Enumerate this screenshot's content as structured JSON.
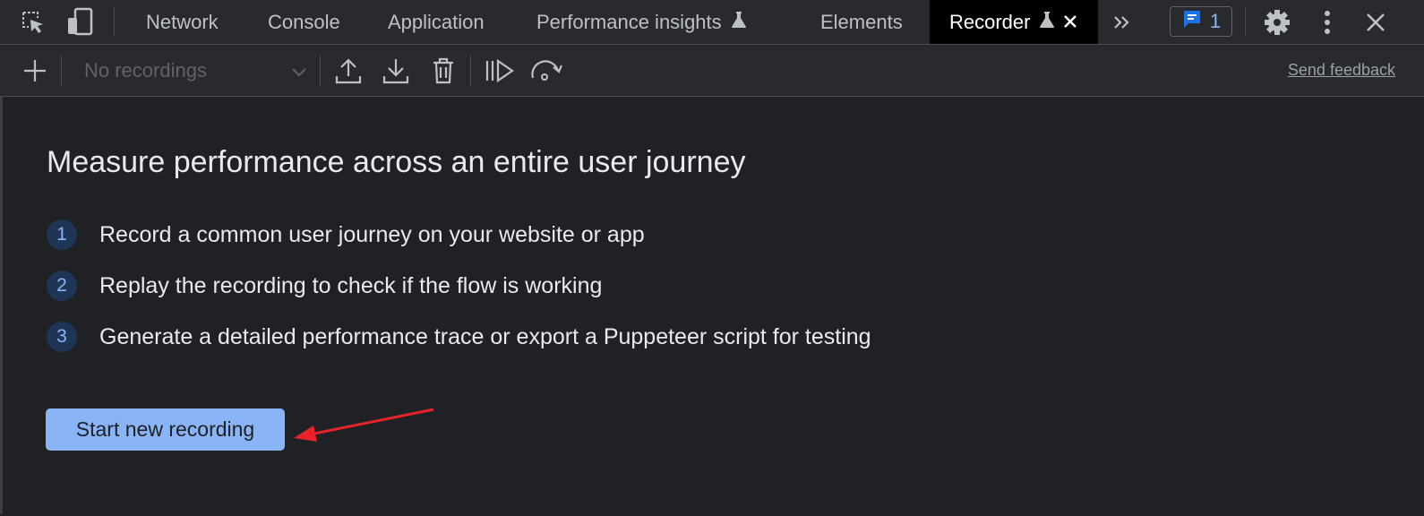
{
  "tabs": [
    {
      "label": "Network",
      "experimental": false
    },
    {
      "label": "Console",
      "experimental": false
    },
    {
      "label": "Application",
      "experimental": false
    },
    {
      "label": "Performance insights",
      "experimental": true
    },
    {
      "label": "Elements",
      "experimental": false
    },
    {
      "label": "Recorder",
      "experimental": true,
      "active": true
    }
  ],
  "issues_count": "1",
  "toolbar": {
    "recordings_select": "No recordings",
    "send_feedback": "Send feedback"
  },
  "main": {
    "title": "Measure performance across an entire user journey",
    "steps": [
      {
        "number": "1",
        "text": "Record a common user journey on your website or app"
      },
      {
        "number": "2",
        "text": "Replay the recording to check if the flow is working"
      },
      {
        "number": "3",
        "text": "Generate a detailed performance trace or export a Puppeteer script for testing"
      }
    ],
    "start_button": "Start new recording"
  },
  "colors": {
    "background": "#202124",
    "accent": "#8ab4f8",
    "annotation_arrow": "#e8222b"
  },
  "icons": [
    "inspect-element-icon",
    "device-toolbar-icon",
    "flask-icon",
    "close-tab-icon",
    "more-tabs-icon",
    "issues-icon",
    "settings-icon",
    "kebab-menu-icon",
    "close-devtools-icon",
    "add-icon",
    "chevron-down-icon",
    "export-icon",
    "import-icon",
    "delete-icon",
    "replay-icon",
    "slow-replay-icon"
  ]
}
